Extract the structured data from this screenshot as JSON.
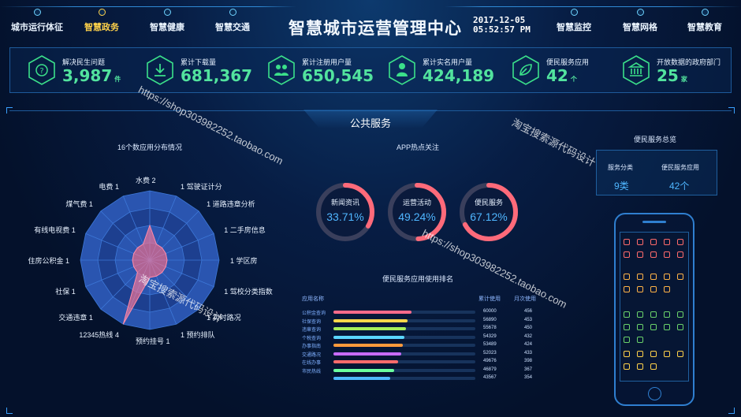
{
  "header": {
    "title": "智慧城市运营管理中心",
    "date": "2017-12-05",
    "time": "05:52:57 PM",
    "nav_left": [
      {
        "label": "城市运行体征",
        "active": false
      },
      {
        "label": "智慧政务",
        "active": true
      },
      {
        "label": "智慧健康",
        "active": false
      },
      {
        "label": "智慧交通",
        "active": false
      }
    ],
    "nav_right": [
      {
        "label": "智慧监控"
      },
      {
        "label": "智慧网格"
      },
      {
        "label": "智慧教育"
      }
    ]
  },
  "stats": [
    {
      "icon": "question-icon",
      "label": "解决民生问题",
      "value": "3,987",
      "unit": "件"
    },
    {
      "icon": "download-icon",
      "label": "累计下载量",
      "value": "681,367",
      "unit": ""
    },
    {
      "icon": "users-icon",
      "label": "累计注册用户量",
      "value": "650,545",
      "unit": ""
    },
    {
      "icon": "user-verified-icon",
      "label": "累计实名用户量",
      "value": "424,189",
      "unit": ""
    },
    {
      "icon": "leaf-icon",
      "label": "便民服务应用",
      "value": "42",
      "unit": "个"
    },
    {
      "icon": "government-building-icon",
      "label": "开放数据的政府部门",
      "value": "25",
      "unit": "家"
    }
  ],
  "section_title": "公共服务",
  "radar": {
    "title": "16个数应用分布情况",
    "labels": [
      "水费",
      "驾驶证计分",
      "道路违章分析",
      "二手房信息",
      "学区房",
      "驾校分类指数",
      "实时路况",
      "预约排队",
      "预约挂号",
      "12345热线",
      "交通违章",
      "社保",
      "住房公积金",
      "有线电视费",
      "煤气费",
      "电费"
    ],
    "values": [
      2,
      1,
      1,
      1,
      1,
      1,
      1,
      1,
      1,
      4,
      1,
      1,
      1,
      1,
      1,
      1
    ],
    "scale_max": 4
  },
  "app_focus": {
    "title": "APP热点关注",
    "items": [
      {
        "name": "新闻资讯",
        "percent": "33.71%",
        "value": 33.71,
        "color": "#ff6a7a"
      },
      {
        "name": "运营活动",
        "percent": "49.24%",
        "value": 49.24,
        "color": "#ff6a7a"
      },
      {
        "name": "便民服务",
        "percent": "67.12%",
        "value": 67.12,
        "color": "#ff6a7a"
      }
    ]
  },
  "ranking": {
    "title": "便民服务应用使用排名",
    "col_name": "应用名称",
    "col_total": "累计使用",
    "col_month": "月次使用",
    "max": 60000,
    "rows": [
      {
        "name": "公积金查询",
        "total": "60000",
        "month": "456",
        "value": 60000,
        "color": "#ff6b8a"
      },
      {
        "name": "社保查询",
        "total": "56890",
        "month": "453",
        "value": 56890,
        "color": "#ffd84a"
      },
      {
        "name": "违章查询",
        "total": "55678",
        "month": "450",
        "value": 55678,
        "color": "#a6f05a"
      },
      {
        "name": "个税查询",
        "total": "54329",
        "month": "432",
        "value": 54329,
        "color": "#5ad7ff"
      },
      {
        "name": "办事指南",
        "total": "53489",
        "month": "424",
        "value": 53489,
        "color": "#ff9a3c"
      },
      {
        "name": "交通路况",
        "total": "52023",
        "month": "433",
        "value": 52023,
        "color": "#c86bff"
      },
      {
        "name": "在线办事",
        "total": "49676",
        "month": "398",
        "value": 49676,
        "color": "#ff6b6b"
      },
      {
        "name": "市民热线",
        "total": "46879",
        "month": "367",
        "value": 46879,
        "color": "#6bff9e"
      },
      {
        "name": "",
        "total": "43567",
        "month": "354",
        "value": 43567,
        "color": "#4db8ff"
      }
    ]
  },
  "summary": {
    "title": "便民服务总览",
    "col1_label": "服务分类",
    "col1_value": "9类",
    "col2_label": "便民服务应用",
    "col2_value": "42个"
  },
  "watermarks": [
    "https://shop303982252.taobao.com",
    "淘宝搜索源代码设计",
    "https://shop303982252.taobao.com",
    "淘宝搜索源代码设计"
  ]
}
